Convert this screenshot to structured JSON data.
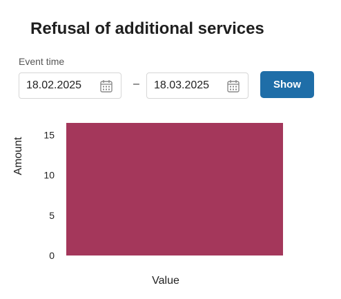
{
  "header": {
    "title": "Refusal of additional services"
  },
  "filter": {
    "label": "Event time",
    "date_from": "18.02.2025",
    "date_to": "18.03.2025",
    "separator": "–",
    "show_label": "Show",
    "calendar_icon": "calendar-icon"
  },
  "colors": {
    "accent": "#1f6ea8",
    "bar": "#a4375b"
  },
  "chart_data": {
    "type": "bar",
    "categories": [
      ""
    ],
    "values": [
      16.5
    ],
    "xlabel": "Value",
    "ylabel": "Amount",
    "ylim": [
      0,
      16.5
    ],
    "yticks": [
      0,
      5,
      10,
      15
    ],
    "grid": false,
    "legend": "none"
  }
}
